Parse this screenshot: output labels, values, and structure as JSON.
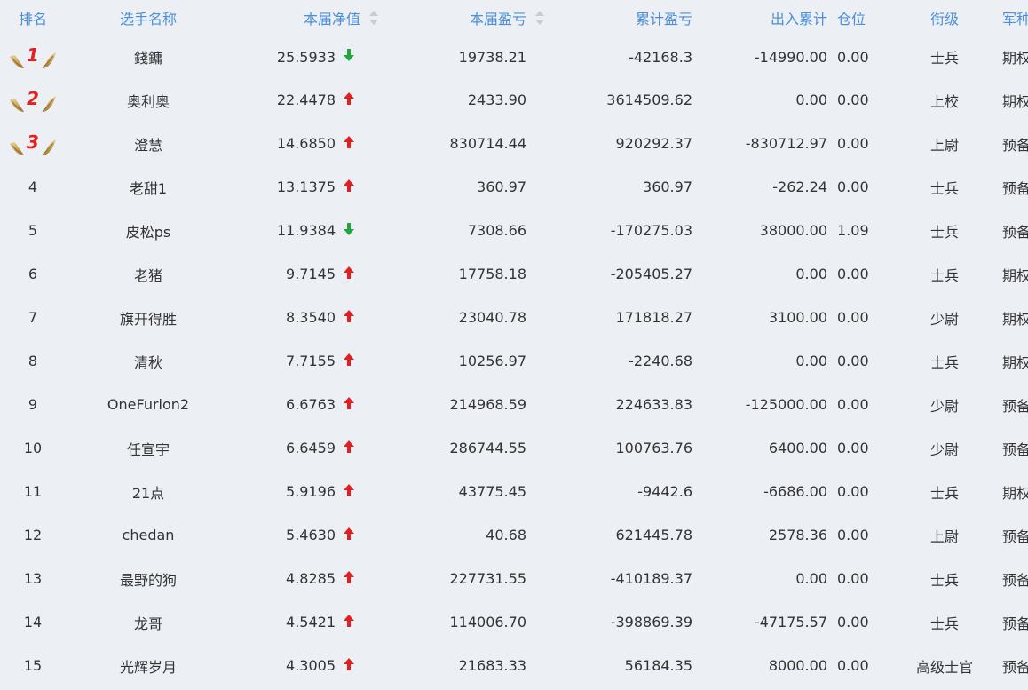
{
  "headers": {
    "rank": "排名",
    "name": "选手名称",
    "nav": "本届净值",
    "pnl": "本届盈亏",
    "cum_pnl": "累计盈亏",
    "flow": "出入累计",
    "position": "仓位",
    "level": "衔级",
    "army": "军种"
  },
  "colors": {
    "header_text": "#4a8fd8",
    "up": "#e02020",
    "down": "#22a53a",
    "background": "#eceff4"
  },
  "rows": [
    {
      "rank": "1",
      "medal": true,
      "name": "錢鏞",
      "nav": "25.5933",
      "trend": "down",
      "pnl": "19738.21",
      "cum_pnl": "-42168.3",
      "flow": "-14990.00",
      "position": "0.00",
      "level": "士兵",
      "army": "期权"
    },
    {
      "rank": "2",
      "medal": true,
      "name": "奥利奥",
      "nav": "22.4478",
      "trend": "up",
      "pnl": "2433.90",
      "cum_pnl": "3614509.62",
      "flow": "0.00",
      "position": "0.00",
      "level": "上校",
      "army": "期权"
    },
    {
      "rank": "3",
      "medal": true,
      "name": "澄慧",
      "nav": "14.6850",
      "trend": "up",
      "pnl": "830714.44",
      "cum_pnl": "920292.37",
      "flow": "-830712.97",
      "position": "0.00",
      "level": "上尉",
      "army": "预备役"
    },
    {
      "rank": "4",
      "name": "老甜1",
      "nav": "13.1375",
      "trend": "up",
      "pnl": "360.97",
      "cum_pnl": "360.97",
      "flow": "-262.24",
      "position": "0.00",
      "level": "士兵",
      "army": "预备役"
    },
    {
      "rank": "5",
      "name": "皮松ps",
      "nav": "11.9384",
      "trend": "down",
      "pnl": "7308.66",
      "cum_pnl": "-170275.03",
      "flow": "38000.00",
      "position": "1.09",
      "level": "士兵",
      "army": "预备役"
    },
    {
      "rank": "6",
      "name": "老猪",
      "nav": "9.7145",
      "trend": "up",
      "pnl": "17758.18",
      "cum_pnl": "-205405.27",
      "flow": "0.00",
      "position": "0.00",
      "level": "士兵",
      "army": "期权"
    },
    {
      "rank": "7",
      "name": "旗开得胜",
      "nav": "8.3540",
      "trend": "up",
      "pnl": "23040.78",
      "cum_pnl": "171818.27",
      "flow": "3100.00",
      "position": "0.00",
      "level": "少尉",
      "army": "期权"
    },
    {
      "rank": "8",
      "name": "清秋",
      "nav": "7.7155",
      "trend": "up",
      "pnl": "10256.97",
      "cum_pnl": "-2240.68",
      "flow": "0.00",
      "position": "0.00",
      "level": "士兵",
      "army": "期权"
    },
    {
      "rank": "9",
      "name": "OneFurion2",
      "nav": "6.6763",
      "trend": "up",
      "pnl": "214968.59",
      "cum_pnl": "224633.83",
      "flow": "-125000.00",
      "position": "0.00",
      "level": "少尉",
      "army": "预备役"
    },
    {
      "rank": "10",
      "name": "任宣宇",
      "nav": "6.6459",
      "trend": "up",
      "pnl": "286744.55",
      "cum_pnl": "100763.76",
      "flow": "6400.00",
      "position": "0.00",
      "level": "少尉",
      "army": "预备役"
    },
    {
      "rank": "11",
      "name": "21点",
      "nav": "5.9196",
      "trend": "up",
      "pnl": "43775.45",
      "cum_pnl": "-9442.6",
      "flow": "-6686.00",
      "position": "0.00",
      "level": "士兵",
      "army": "期权"
    },
    {
      "rank": "12",
      "name": "chedan",
      "nav": "5.4630",
      "trend": "up",
      "pnl": "40.68",
      "cum_pnl": "621445.78",
      "flow": "2578.36",
      "position": "0.00",
      "level": "上尉",
      "army": "预备役"
    },
    {
      "rank": "13",
      "name": "最野的狗",
      "nav": "4.8285",
      "trend": "up",
      "pnl": "227731.55",
      "cum_pnl": "-410189.37",
      "flow": "0.00",
      "position": "0.00",
      "level": "士兵",
      "army": "预备役"
    },
    {
      "rank": "14",
      "name": "龙哥",
      "nav": "4.5421",
      "trend": "up",
      "pnl": "114006.70",
      "cum_pnl": "-398869.39",
      "flow": "-47175.57",
      "position": "0.00",
      "level": "士兵",
      "army": "预备役"
    },
    {
      "rank": "15",
      "name": "光辉岁月",
      "nav": "4.3005",
      "trend": "up",
      "pnl": "21683.33",
      "cum_pnl": "56184.35",
      "flow": "8000.00",
      "position": "0.00",
      "level": "高级士官",
      "army": "预备役"
    }
  ]
}
